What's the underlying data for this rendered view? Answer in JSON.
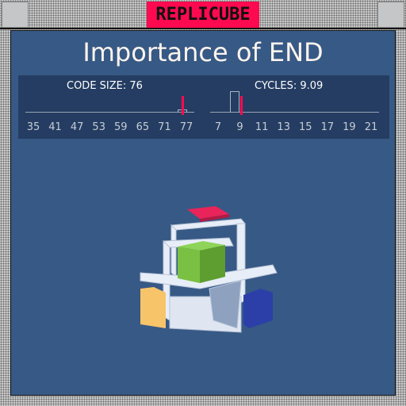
{
  "app": {
    "title": "REPLICUBE"
  },
  "puzzle": {
    "title": "Importance of END"
  },
  "stats": {
    "code_size": {
      "label": "CODE SIZE: 76",
      "value": 76,
      "ticks": [
        "35",
        "41",
        "47",
        "53",
        "59",
        "65",
        "71",
        "77"
      ],
      "range": [
        35,
        77
      ],
      "histogram": [
        {
          "x": 76,
          "level": 0.1
        }
      ]
    },
    "cycles": {
      "label": "CYCLES: 9.09",
      "value": 9.09,
      "ticks": [
        "7",
        "9",
        "11",
        "13",
        "15",
        "17",
        "19",
        "21"
      ],
      "range": [
        7,
        21
      ],
      "histogram": [
        {
          "x": 8.5,
          "level": 1
        }
      ]
    }
  },
  "colors": {
    "accent": "#ff0a50",
    "panel": "#375985",
    "stats_bg": "#253d62",
    "cube_white": "#e8eef8",
    "cube_green": "#7ac143",
    "cube_red": "#e8245a",
    "cube_yellow": "#f7c46a",
    "cube_blue": "#2c3fa8"
  }
}
